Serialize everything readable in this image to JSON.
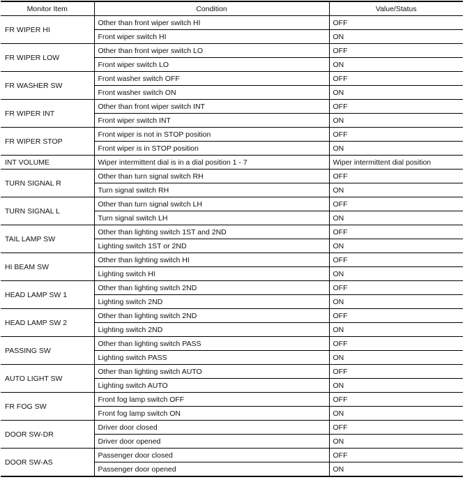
{
  "headers": [
    "Monitor Item",
    "Condition",
    "Value/Status"
  ],
  "rows": [
    {
      "item": "FR WIPER HI",
      "entries": [
        [
          "Other than front wiper switch HI",
          "OFF"
        ],
        [
          "Front wiper switch HI",
          "ON"
        ]
      ]
    },
    {
      "item": "FR WIPER LOW",
      "entries": [
        [
          "Other than front wiper switch LO",
          "OFF"
        ],
        [
          "Front wiper switch LO",
          "ON"
        ]
      ]
    },
    {
      "item": "FR WASHER SW",
      "entries": [
        [
          "Front washer switch OFF",
          "OFF"
        ],
        [
          "Front washer switch ON",
          "ON"
        ]
      ]
    },
    {
      "item": "FR WIPER INT",
      "entries": [
        [
          "Other than front wiper switch INT",
          "OFF"
        ],
        [
          "Front wiper switch INT",
          "ON"
        ]
      ]
    },
    {
      "item": "FR WIPER STOP",
      "entries": [
        [
          "Front wiper is not in STOP position",
          "OFF"
        ],
        [
          "Front wiper is in STOP position",
          "ON"
        ]
      ]
    },
    {
      "item": "INT VOLUME",
      "entries": [
        [
          "Wiper intermittent dial is in a dial position 1 - 7",
          "Wiper intermittent dial position"
        ]
      ]
    },
    {
      "item": "TURN SIGNAL R",
      "entries": [
        [
          "Other than turn signal switch RH",
          "OFF"
        ],
        [
          "Turn signal switch RH",
          "ON"
        ]
      ]
    },
    {
      "item": "TURN SIGNAL L",
      "entries": [
        [
          "Other than turn signal switch LH",
          "OFF"
        ],
        [
          "Turn signal switch LH",
          "ON"
        ]
      ]
    },
    {
      "item": "TAIL LAMP SW",
      "entries": [
        [
          "Other than lighting switch 1ST and 2ND",
          "OFF"
        ],
        [
          "Lighting switch 1ST or 2ND",
          "ON"
        ]
      ]
    },
    {
      "item": "HI BEAM SW",
      "entries": [
        [
          "Other than lighting switch HI",
          "OFF"
        ],
        [
          "Lighting switch HI",
          "ON"
        ]
      ]
    },
    {
      "item": "HEAD LAMP SW 1",
      "entries": [
        [
          "Other than lighting switch 2ND",
          "OFF"
        ],
        [
          "Lighting switch 2ND",
          "ON"
        ]
      ]
    },
    {
      "item": "HEAD LAMP SW 2",
      "entries": [
        [
          "Other than lighting switch 2ND",
          "OFF"
        ],
        [
          "Lighting switch 2ND",
          "ON"
        ]
      ]
    },
    {
      "item": "PASSING SW",
      "entries": [
        [
          "Other than lighting switch PASS",
          "OFF"
        ],
        [
          "Lighting switch PASS",
          "ON"
        ]
      ]
    },
    {
      "item": "AUTO LIGHT SW",
      "entries": [
        [
          "Other than lighting switch AUTO",
          "OFF"
        ],
        [
          "Lighting switch AUTO",
          "ON"
        ]
      ]
    },
    {
      "item": "FR FOG SW",
      "entries": [
        [
          "Front fog lamp switch OFF",
          "OFF"
        ],
        [
          "Front fog lamp switch ON",
          "ON"
        ]
      ]
    },
    {
      "item": "DOOR SW-DR",
      "entries": [
        [
          "Driver door closed",
          "OFF"
        ],
        [
          "Driver door opened",
          "ON"
        ]
      ]
    },
    {
      "item": "DOOR SW-AS",
      "entries": [
        [
          "Passenger door closed",
          "OFF"
        ],
        [
          "Passenger door opened",
          "ON"
        ]
      ]
    }
  ]
}
